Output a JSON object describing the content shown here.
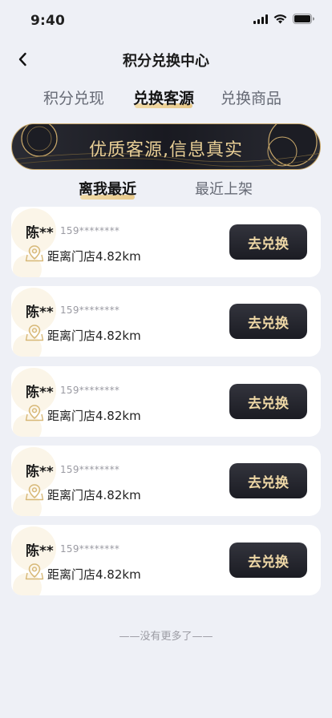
{
  "status_bar": {
    "time": "9:40"
  },
  "nav": {
    "title": "积分兑换中心"
  },
  "tabs": [
    {
      "label": "积分兑现",
      "active": false
    },
    {
      "label": "兑换客源",
      "active": true
    },
    {
      "label": "兑换商品",
      "active": false
    }
  ],
  "banner": {
    "text": "优质客源,信息真实"
  },
  "sort_tabs": [
    {
      "label": "离我最近",
      "active": true
    },
    {
      "label": "最近上架",
      "active": false
    }
  ],
  "cards": [
    {
      "name": "陈**",
      "phone": "159********",
      "distance": "距离门店4.82km",
      "button": "去兑换"
    },
    {
      "name": "陈**",
      "phone": "159********",
      "distance": "距离门店4.82km",
      "button": "去兑换"
    },
    {
      "name": "陈**",
      "phone": "159********",
      "distance": "距离门店4.82km",
      "button": "去兑换"
    },
    {
      "name": "陈**",
      "phone": "159********",
      "distance": "距离门店4.82km",
      "button": "去兑换"
    },
    {
      "name": "陈**",
      "phone": "159********",
      "distance": "距离门店4.82km",
      "button": "去兑换"
    }
  ],
  "footer": {
    "text": "——没有更多了——"
  },
  "colors": {
    "background": "#eef0f6",
    "accent_gold": "#e9cf96",
    "button_dark": "#1b1c23"
  }
}
